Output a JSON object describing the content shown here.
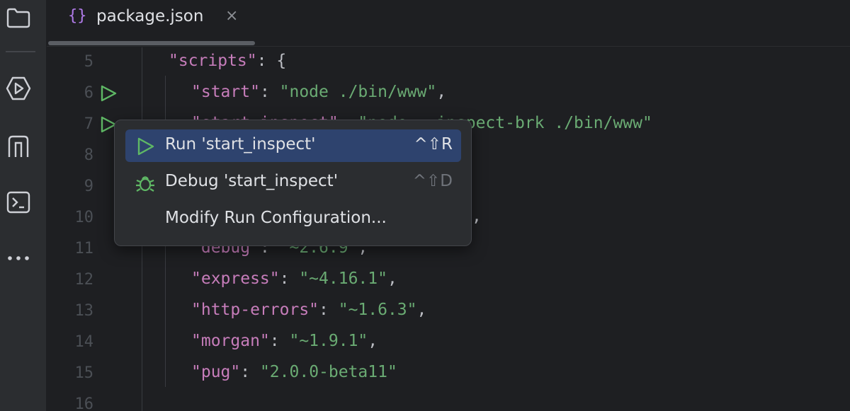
{
  "activity_bar": {
    "icons": [
      "folder-icon",
      "run-debug-icon",
      "git-icon",
      "terminal-icon",
      "more-icon"
    ],
    "more_label": "•••"
  },
  "tab": {
    "file_icon": "{}",
    "label": "package.json",
    "close": "×"
  },
  "editor": {
    "line_numbers": [
      "5",
      "6",
      "7",
      "8",
      "9",
      "10",
      "11",
      "12",
      "13",
      "14",
      "15",
      "16"
    ],
    "lines": {
      "l5": {
        "key": "\"scripts\"",
        "punct": ": {"
      },
      "l6": {
        "key": "\"start\"",
        "punct": ": ",
        "value": "\"node ./bin/www\"",
        "tail": ","
      },
      "l7": {
        "key": "\"start_inspect\"",
        "punct": ": ",
        "value": "\"node --inspect-brk ./bin/www\""
      },
      "l10_tail": ",",
      "l11": {
        "key": "\"debug\"",
        "punct": ": ",
        "value": "\"~2.6.9\"",
        "tail": ","
      },
      "l12": {
        "key": "\"express\"",
        "punct": ": ",
        "value": "\"~4.16.1\"",
        "tail": ","
      },
      "l13": {
        "key": "\"http-errors\"",
        "punct": ": ",
        "value": "\"~1.6.3\"",
        "tail": ","
      },
      "l14": {
        "key": "\"morgan\"",
        "punct": ": ",
        "value": "\"~1.9.1\"",
        "tail": ","
      },
      "l15": {
        "key": "\"pug\"",
        "punct": ": ",
        "value": "\"2.0.0-beta11\""
      }
    }
  },
  "popup": {
    "items": [
      {
        "label": "Run 'start_inspect'",
        "shortcut": "^⇧R",
        "icon": "run-icon"
      },
      {
        "label": "Debug 'start_inspect'",
        "shortcut": "^⇧D",
        "icon": "bug-icon"
      },
      {
        "label": "Modify Run Configuration..."
      }
    ]
  },
  "colors": {
    "selection": "#2e436e",
    "string": "#6aab73",
    "key": "#c77dbb",
    "run_green": "#5fb865"
  }
}
